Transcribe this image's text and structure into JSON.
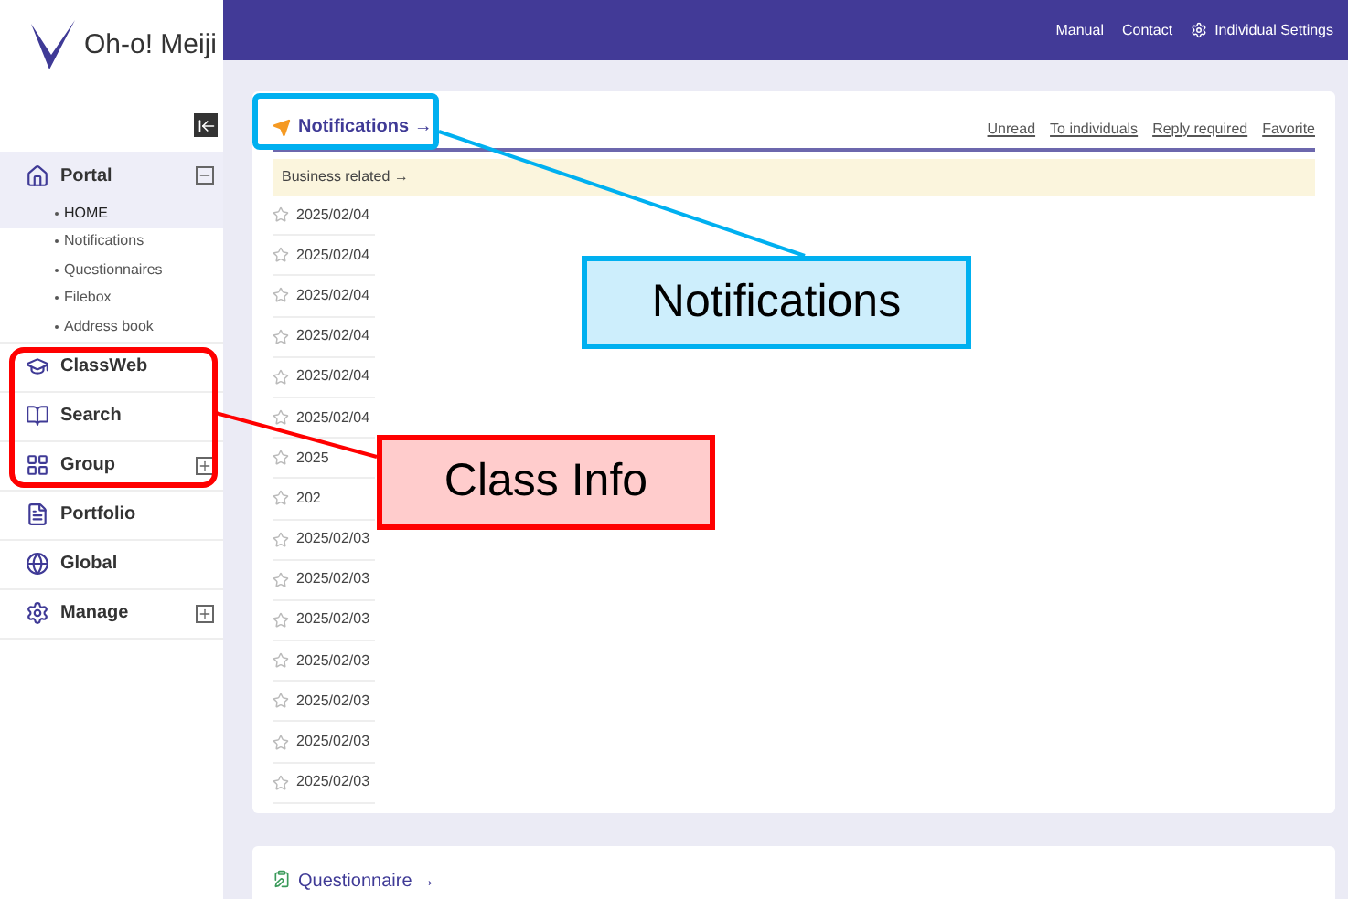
{
  "logo": {
    "text": "Oh-o! Meiji"
  },
  "header": {
    "links": [
      {
        "label": "Manual",
        "kind": "text"
      },
      {
        "label": "Contact",
        "kind": "text"
      },
      {
        "label": "Individual Settings",
        "kind": "settings"
      }
    ]
  },
  "sidebar": {
    "items": [
      {
        "label": "Portal",
        "expanded": true,
        "children": [
          {
            "label": "HOME",
            "selected": true
          },
          {
            "label": "Notifications",
            "selected": false
          },
          {
            "label": "Questionnaires",
            "selected": false
          },
          {
            "label": "Filebox",
            "selected": false
          },
          {
            "label": "Address book",
            "selected": false
          }
        ]
      },
      {
        "label": "ClassWeb"
      },
      {
        "label": "Search"
      },
      {
        "label": "Group",
        "expanded": false
      },
      {
        "label": "Portfolio"
      },
      {
        "label": "Global"
      },
      {
        "label": "Manage",
        "expanded": false
      }
    ]
  },
  "notifications": {
    "title": "Notifications →",
    "filters": [
      "Unread",
      "To individuals",
      "Reply required",
      "Favorite"
    ],
    "category": "Business related →",
    "rows": [
      {
        "date": "2025/02/04",
        "starred": false
      },
      {
        "date": "2025/02/04",
        "starred": false
      },
      {
        "date": "2025/02/04",
        "starred": false
      },
      {
        "date": "2025/02/04",
        "starred": false
      },
      {
        "date": "2025/02/04",
        "starred": false
      },
      {
        "date": "2025/02/04",
        "starred": false
      },
      {
        "date": "2025",
        "starred": false
      },
      {
        "date": "202",
        "starred": false
      },
      {
        "date": "2025/02/03",
        "starred": false
      },
      {
        "date": "2025/02/03",
        "starred": false
      },
      {
        "date": "2025/02/03",
        "starred": false
      },
      {
        "date": "2025/02/03",
        "starred": false
      },
      {
        "date": "2025/02/03",
        "starred": false
      },
      {
        "date": "2025/02/03",
        "starred": false
      },
      {
        "date": "2025/02/03",
        "starred": false
      }
    ]
  },
  "questionnaire": {
    "title": "Questionnaire →"
  },
  "callouts": [
    {
      "text": "Notifications",
      "color": "#00b0f0"
    },
    {
      "text": "Class Info",
      "color": "#ff0000"
    }
  ]
}
